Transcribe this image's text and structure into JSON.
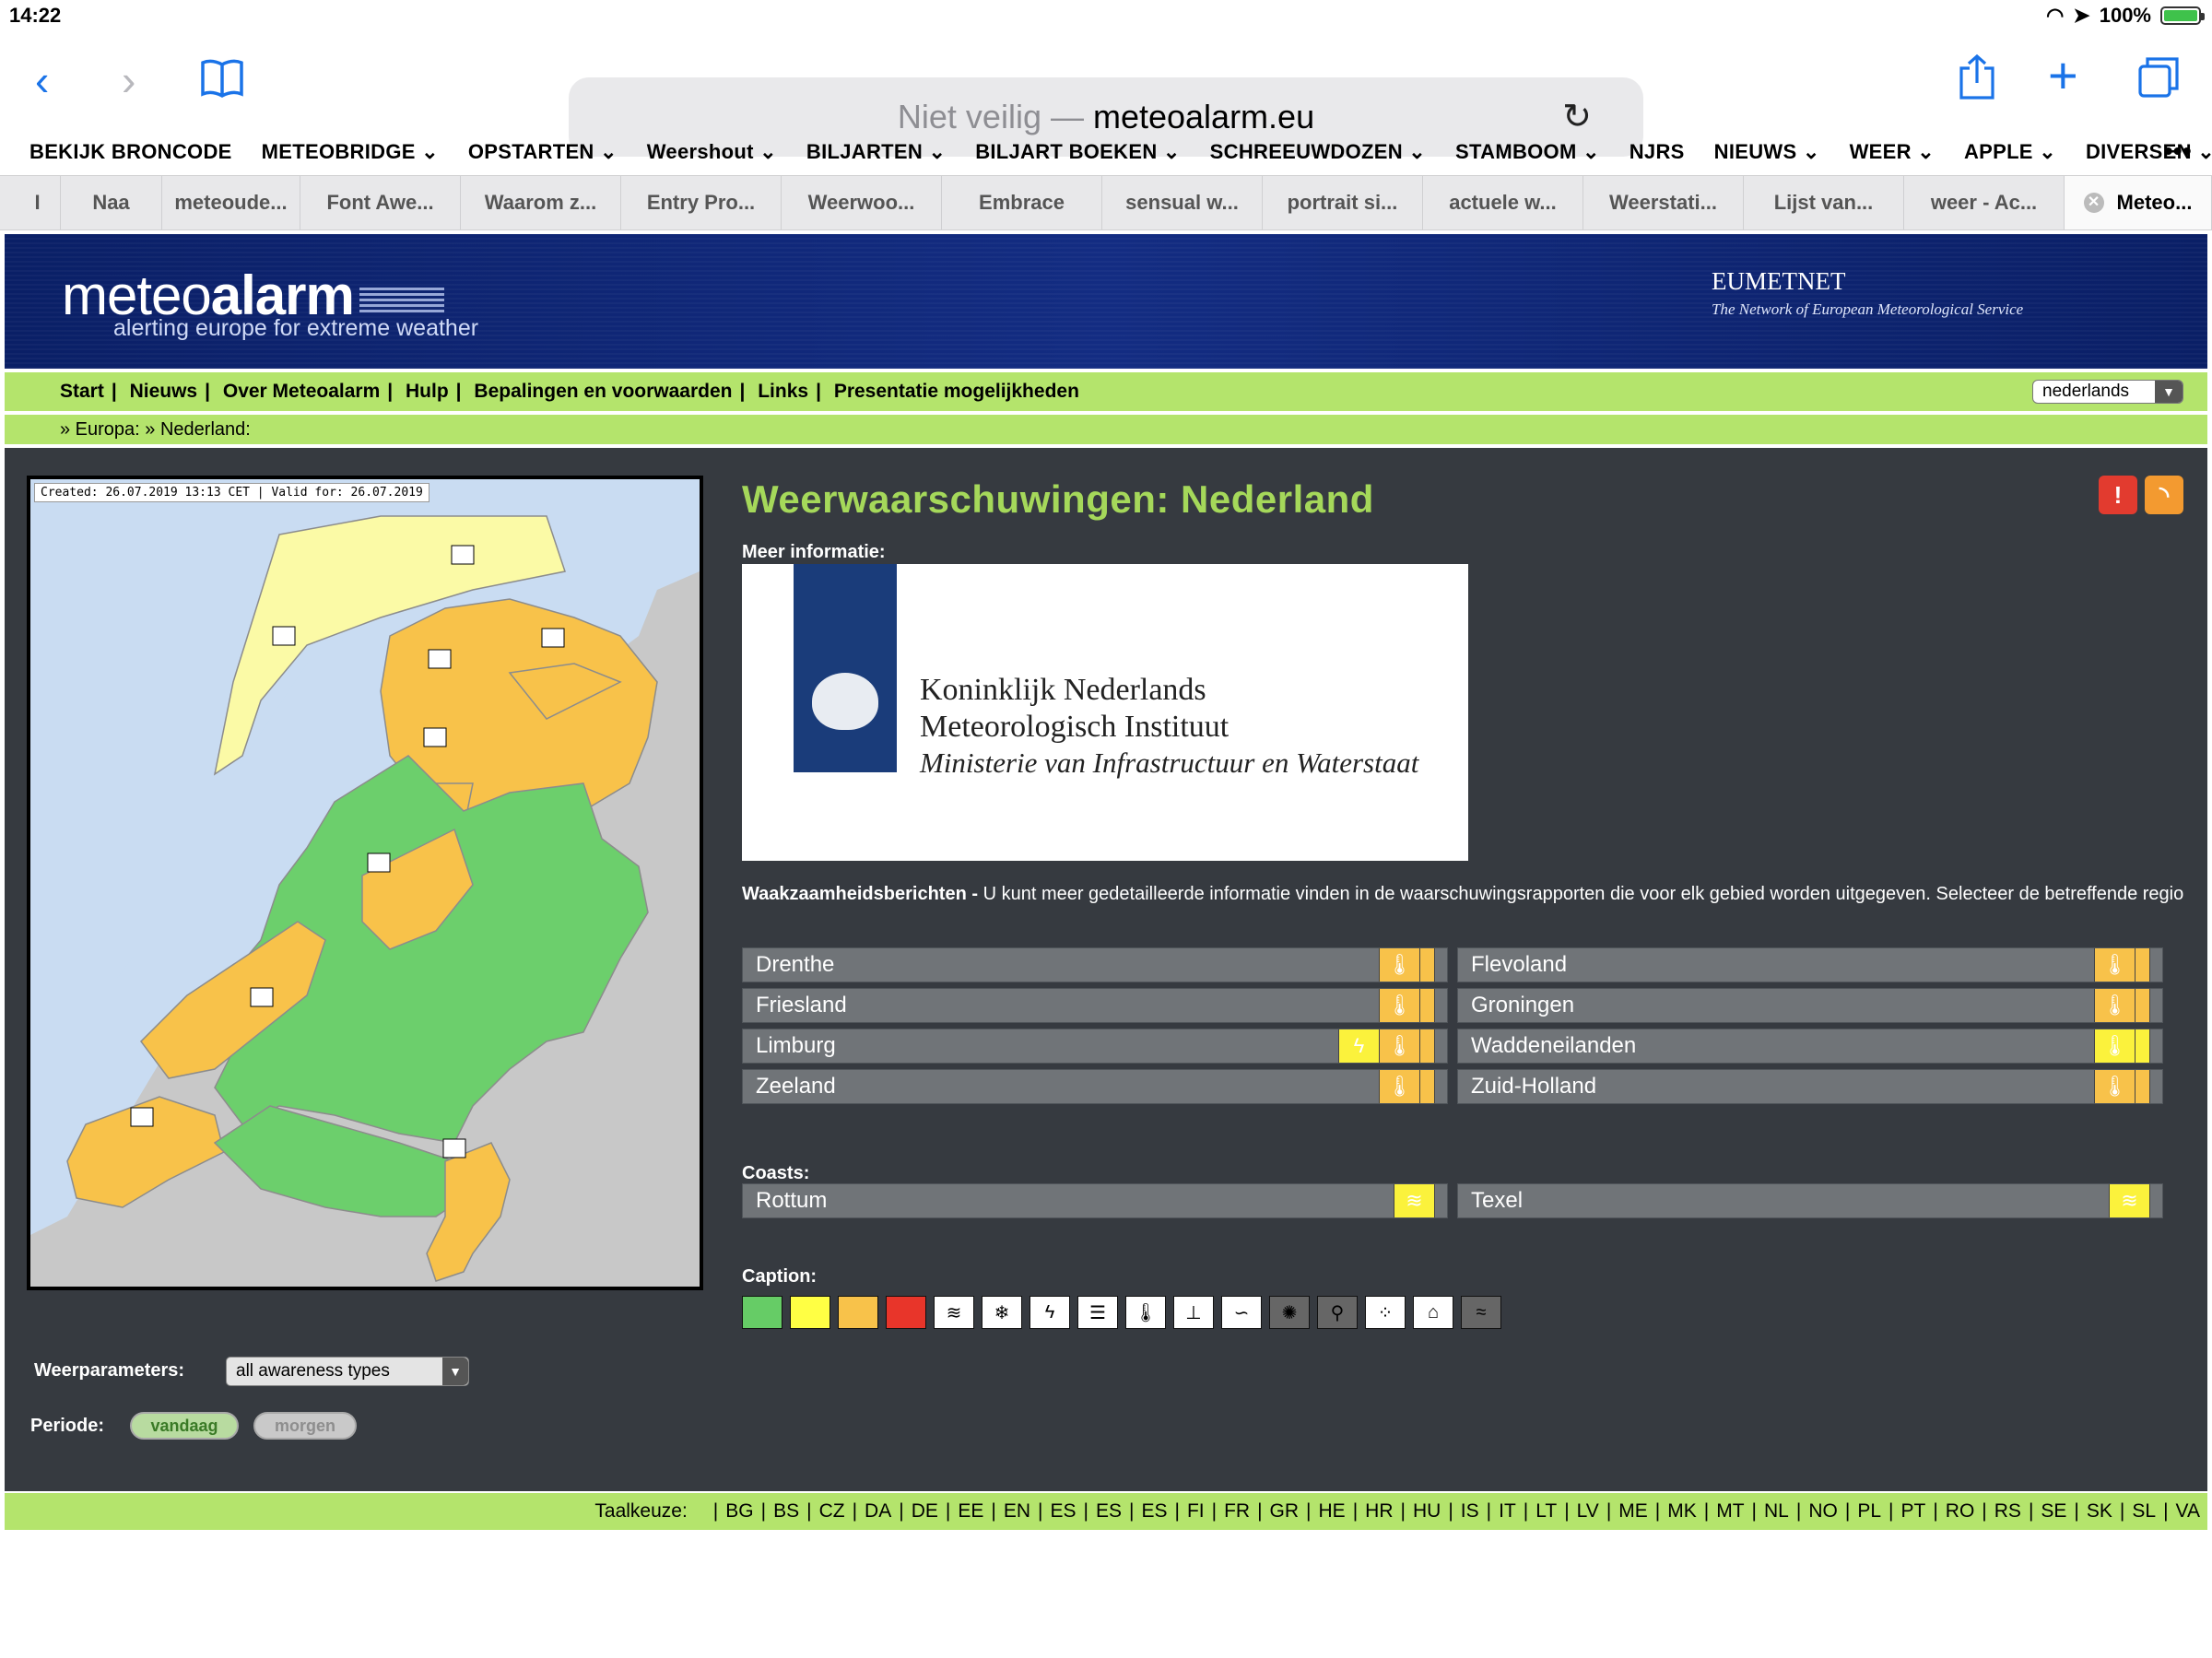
{
  "status": {
    "time": "14:22",
    "battery": "100%"
  },
  "browser": {
    "address_prefix": "Niet veilig —",
    "address_domain": "meteoalarm.eu",
    "bookmarks": [
      "BEKIJK BRONCODE",
      "METEOBRIDGE ⌄",
      "OPSTARTEN ⌄",
      "Weershout ⌄",
      "BILJARTEN ⌄",
      "BILJART BOEKEN ⌄",
      "SCHREEUWDOZEN ⌄",
      "STAMBOOM ⌄",
      "NJRS",
      "NIEUWS ⌄",
      "WEER ⌄",
      "APPLE ⌄",
      "DIVERSEN ⌄"
    ],
    "more": "•••",
    "tabs": [
      "I",
      "Naa",
      "meteoude...",
      "Font Awe...",
      "Waarom z...",
      "Entry Pro...",
      "Weerwoo...",
      "Embrace",
      "sensual w...",
      "portrait si...",
      "actuele w...",
      "Weerstati...",
      "Lijst van...",
      "weer - Ac...",
      "Meteo..."
    ]
  },
  "site": {
    "logo_light": "meteo",
    "logo_bold": "alarm",
    "tagline": "alerting europe for extreme weather",
    "eumetnet": "EUMETNET",
    "eumetnet_sub": "The Network of European Meteorological Service",
    "nav": [
      "Start",
      "Nieuws",
      "Over Meteoalarm",
      "Hulp",
      "Bepalingen en voorwaarden",
      "Links",
      "Presentatie mogelijkheden"
    ],
    "language_selected": "nederlands",
    "breadcrumb": "» Europa: » Nederland:"
  },
  "map": {
    "caption": "Created: 26.07.2019 13:13 CET | Valid for: 26.07.2019"
  },
  "filters": {
    "weerparameters_label": "Weerparameters:",
    "weerparameters_value": "all awareness types",
    "periode_label": "Periode:",
    "today": "vandaag",
    "tomorrow": "morgen"
  },
  "main": {
    "title": "Weerwaarschuwingen: Nederland",
    "meer_informatie": "Meer informatie:",
    "knmi_line1": "Koninklijk Nederlands",
    "knmi_line2": "Meteorologisch Instituut",
    "knmi_line3": "Ministerie van Infrastructuur en Waterstaat",
    "waak_bold": "Waakzaamheidsberichten -",
    "waak_text": "U kunt meer gedetailleerde informatie vinden in de waarschuwingsrapporten die voor elk gebied worden uitgegeven. Selecteer de betreffende regio",
    "regions": [
      "Drenthe",
      "Friesland",
      "Limburg",
      "Zeeland",
      "Flevoland",
      "Groningen",
      "Waddeneilanden",
      "Zuid-Holland"
    ],
    "coasts_label": "Coasts:",
    "coasts": [
      "Rottum",
      "Texel"
    ],
    "caption_label": "Caption:"
  },
  "colors": {
    "green": "#66cc66",
    "yellow": "#ffff44",
    "orange": "#f8c24a",
    "red": "#e8352a",
    "nav_green": "#b4e46c",
    "title_green": "#a5d85a"
  },
  "footer": {
    "label": "Taalkeuze:",
    "languages": [
      "BG",
      "BS",
      "CZ",
      "DA",
      "DE",
      "EE",
      "EN",
      "ES",
      "ES",
      "ES",
      "FI",
      "FR",
      "GR",
      "HE",
      "HR",
      "HU",
      "IS",
      "IT",
      "LT",
      "LV",
      "ME",
      "MK",
      "MT",
      "NL",
      "NO",
      "PL",
      "PT",
      "RO",
      "RS",
      "SE",
      "SK",
      "SL",
      "VA"
    ]
  }
}
